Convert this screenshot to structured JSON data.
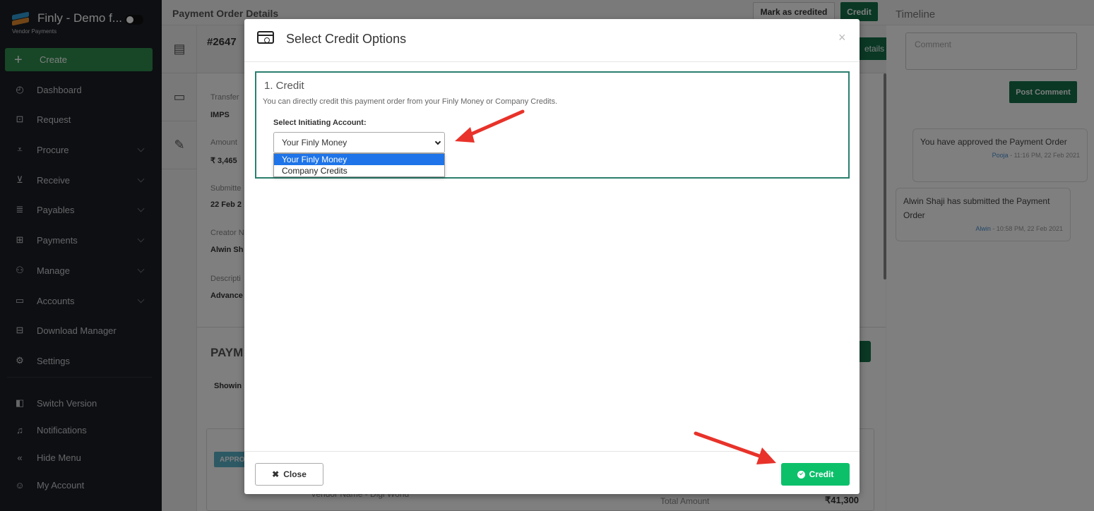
{
  "sidebar": {
    "brand_title": "Finly - Demo f...",
    "brand_subtitle": "Vendor Payments",
    "create_label": "Create",
    "items": [
      {
        "label": "Dashboard",
        "icon": "dashboard-icon"
      },
      {
        "label": "Request",
        "icon": "request-icon"
      },
      {
        "label": "Procure",
        "icon": "cart-icon"
      },
      {
        "label": "Receive",
        "icon": "receive-icon"
      },
      {
        "label": "Payables",
        "icon": "payables-icon"
      },
      {
        "label": "Payments",
        "icon": "payments-icon"
      },
      {
        "label": "Manage",
        "icon": "users-icon"
      },
      {
        "label": "Accounts",
        "icon": "wallet-icon"
      },
      {
        "label": "Download Manager",
        "icon": "download-icon"
      },
      {
        "label": "Settings",
        "icon": "gear-icon"
      },
      {
        "label": "Switch Version",
        "icon": "switch-icon"
      },
      {
        "label": "Notifications",
        "icon": "bell-icon"
      },
      {
        "label": "Hide Menu",
        "icon": "double-chevron-left-icon"
      },
      {
        "label": "My Account",
        "icon": "user-icon"
      }
    ]
  },
  "header": {
    "title": "Payment Order Details",
    "mark_credited": "Mark as credited",
    "credit": "Credit",
    "timeline": "Timeline"
  },
  "background": {
    "order_id": "#2647",
    "details_btn": "etails",
    "transfer_label": "Transfer",
    "transfer_value": "IMPS",
    "amount_label": "Amount",
    "amount_value": "₹ 3,465",
    "submitted_label": "Submitte",
    "submitted_value": "22 Feb 2",
    "creator_label": "Creator N",
    "creator_value": "Alwin Sh",
    "description_label": "Descripti",
    "description_value": "Advance",
    "section_title": "PAYM",
    "showing": "Showin",
    "approved_tag": "APPRO",
    "vendor_name": "Vendor Name - Digi World",
    "total_amount": "Total Amount",
    "total_value": "₹41,300"
  },
  "timeline": {
    "comment_placeholder": "Comment",
    "post_comment": "Post Comment",
    "entries": [
      {
        "text": "You have approved the Payment Order",
        "who": "Pooja",
        "when": " - 11:16 PM, 22 Feb 2021"
      },
      {
        "text": "Alwin Shaji has submitted the Payment Order",
        "who": "Alwin",
        "when": " - 10:58 PM, 22 Feb 2021"
      }
    ]
  },
  "modal": {
    "title": "Select Credit Options",
    "close_x": "×",
    "section_title": "1. Credit",
    "section_desc": "You can directly credit this payment order from your Finly Money or Company Credits.",
    "select_label": "Select Initiating Account:",
    "selected_value": "Your Finly Money",
    "options": [
      "Your Finly Money",
      "Company Credits"
    ],
    "close_btn": "Close",
    "credit_btn": "Credit"
  },
  "colors": {
    "brand_green": "#14704a",
    "create_green": "#2f8f4e",
    "credit_green": "#0cc06a",
    "annotation_red": "#e8322a"
  }
}
